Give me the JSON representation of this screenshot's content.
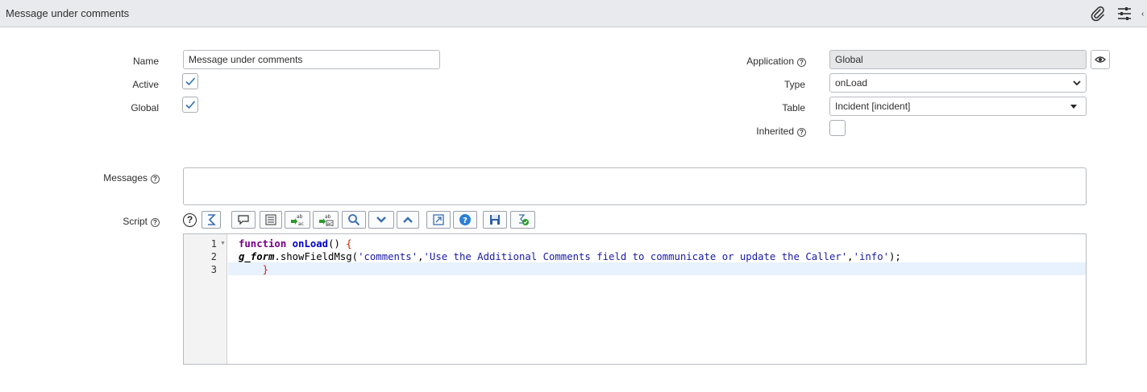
{
  "header": {
    "title": "Message under comments",
    "icons": [
      "paperclip-icon",
      "settings-sliders-icon"
    ]
  },
  "form": {
    "name": {
      "label": "Name",
      "value": "Message under comments"
    },
    "active": {
      "label": "Active",
      "checked": true
    },
    "global": {
      "label": "Global",
      "checked": true
    },
    "application": {
      "label": "Application",
      "value": "Global"
    },
    "type": {
      "label": "Type",
      "value": "onLoad"
    },
    "table": {
      "label": "Table",
      "value": "Incident [incident]"
    },
    "inherited": {
      "label": "Inherited",
      "checked": false
    },
    "messages": {
      "label": "Messages",
      "value": ""
    },
    "script": {
      "label": "Script"
    }
  },
  "toolbar": {
    "buttons": [
      "help-icon",
      "format-icon",
      "comment-icon",
      "align-icon",
      "replace-icon",
      "replace-all-icon",
      "search-icon",
      "collapse-icon",
      "expand-icon",
      "fullscreen-icon",
      "info-icon",
      "save-icon",
      "check-syntax-icon"
    ]
  },
  "code": {
    "line_numbers": [
      "1",
      "2",
      "3"
    ],
    "line1": {
      "kw": "function",
      "fn": "onLoad",
      "rest": "() ",
      "brace": "{"
    },
    "line2": {
      "var": "g_form",
      "call": ".showFieldMsg(",
      "arg1": "'comments'",
      "sep1": ",",
      "arg2": "'Use the Additional Comments field to communicate or update the Caller'",
      "sep2": ",",
      "arg3": "'info'",
      "end": ");"
    },
    "line3": {
      "indent": "    ",
      "brace": "}"
    }
  },
  "colors": {
    "header_bg": "#e8eaed",
    "checkbox_check": "#2f6fb5",
    "active_line": "#e8f2fe"
  }
}
